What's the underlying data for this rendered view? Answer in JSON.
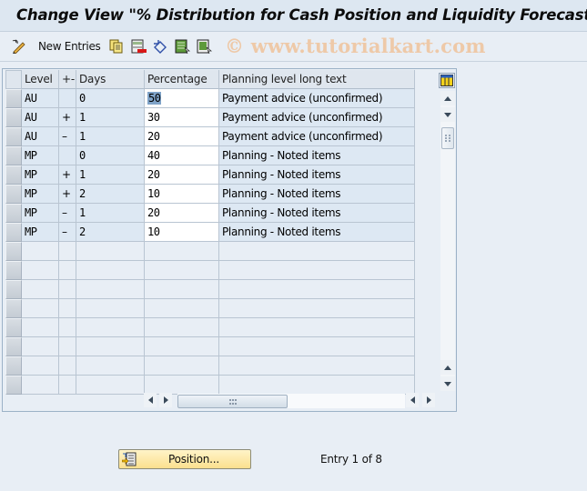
{
  "title": "Change View \"% Distribution for Cash Position and Liquidity Forecast\":",
  "toolbar": {
    "new_entries_label": "New Entries",
    "icons": [
      "display-change-icon",
      "copy-icon",
      "delete-icon",
      "undo-icon",
      "select-all-icon",
      "deselect-all-icon"
    ]
  },
  "watermark": "© www.tutorialkart.com",
  "table": {
    "columns": [
      "Level",
      "+-",
      "Days",
      "Percentage",
      "Planning level long text"
    ],
    "rows": [
      {
        "level": "AU",
        "sign": "",
        "days": "0",
        "percentage": "50",
        "text": "Payment advice (unconfirmed)"
      },
      {
        "level": "AU",
        "sign": "+",
        "days": "1",
        "percentage": "30",
        "text": "Payment advice (unconfirmed)"
      },
      {
        "level": "AU",
        "sign": "–",
        "days": "1",
        "percentage": "20",
        "text": "Payment advice (unconfirmed)"
      },
      {
        "level": "MP",
        "sign": "",
        "days": "0",
        "percentage": "40",
        "text": "Planning - Noted items"
      },
      {
        "level": "MP",
        "sign": "+",
        "days": "1",
        "percentage": "20",
        "text": "Planning - Noted items"
      },
      {
        "level": "MP",
        "sign": "+",
        "days": "2",
        "percentage": "10",
        "text": "Planning - Noted items"
      },
      {
        "level": "MP",
        "sign": "–",
        "days": "1",
        "percentage": "20",
        "text": "Planning - Noted items"
      },
      {
        "level": "MP",
        "sign": "–",
        "days": "2",
        "percentage": "10",
        "text": "Planning - Noted items"
      }
    ],
    "empty_rows": 8
  },
  "footer": {
    "position_button_label": "Position...",
    "entry_info": "Entry 1 of 8"
  }
}
